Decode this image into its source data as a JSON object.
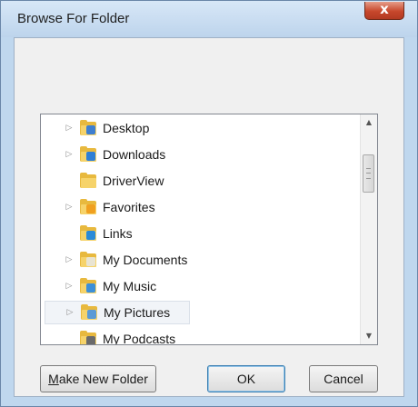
{
  "window": {
    "title": "Browse For Folder",
    "close_label": "x"
  },
  "tree": {
    "items": [
      {
        "label": "Desktop",
        "expandable": true,
        "selected": false,
        "icon": "desktop-folder-icon"
      },
      {
        "label": "Downloads",
        "expandable": true,
        "selected": false,
        "icon": "downloads-folder-icon"
      },
      {
        "label": "DriverView",
        "expandable": false,
        "selected": false,
        "icon": "folder-icon"
      },
      {
        "label": "Favorites",
        "expandable": true,
        "selected": false,
        "icon": "favorites-folder-icon"
      },
      {
        "label": "Links",
        "expandable": false,
        "selected": false,
        "icon": "links-folder-icon"
      },
      {
        "label": "My Documents",
        "expandable": true,
        "selected": false,
        "icon": "documents-folder-icon"
      },
      {
        "label": "My Music",
        "expandable": true,
        "selected": false,
        "icon": "music-folder-icon"
      },
      {
        "label": "My Pictures",
        "expandable": true,
        "selected": true,
        "icon": "pictures-folder-icon"
      },
      {
        "label": "My Podcasts",
        "expandable": false,
        "selected": false,
        "icon": "podcasts-folder-icon"
      }
    ],
    "expander_glyph": "▷"
  },
  "buttons": {
    "make_new_folder_prefix": "M",
    "make_new_folder_rest": "ake New Folder",
    "ok": "OK",
    "cancel": "Cancel"
  },
  "colors": {
    "title_bar": "#bdd4ec",
    "close_button": "#c7472c",
    "dialog_background": "#f0f0f0",
    "folder_yellow": "#e8b93e",
    "default_button_border": "#3c7fb1"
  }
}
